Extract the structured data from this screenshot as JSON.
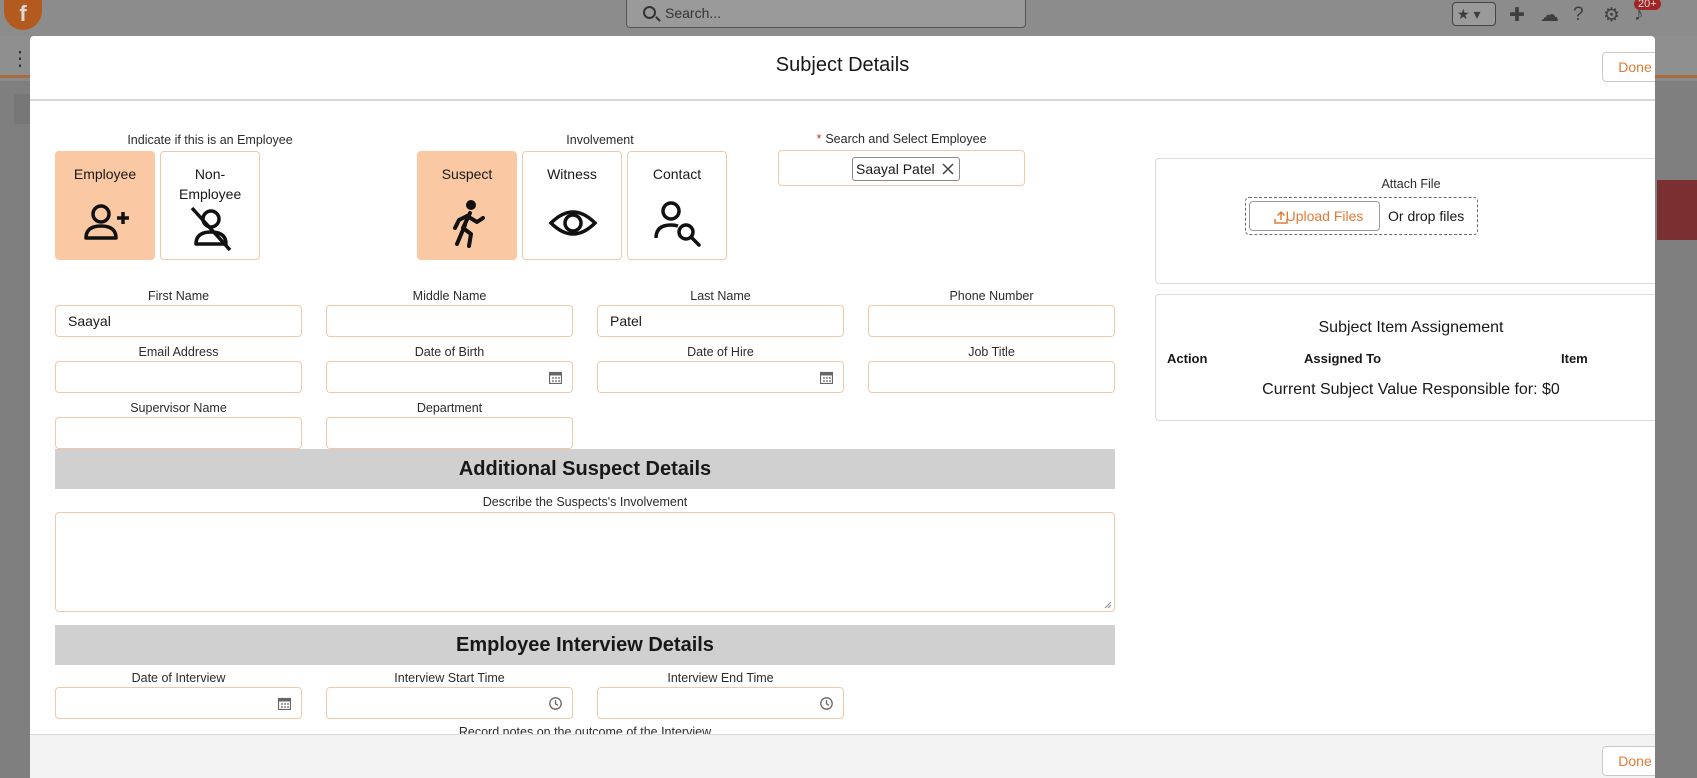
{
  "background": {
    "search_placeholder": "Search...",
    "notification_badge": "20+"
  },
  "modal": {
    "title": "Subject Details",
    "done_label": "Done"
  },
  "employee_indicator": {
    "label": "Indicate if this is an Employee",
    "options": [
      {
        "label": "Employee",
        "selected": true,
        "icon": "add-user-icon"
      },
      {
        "label": "Non-Employee",
        "selected": false,
        "icon": "user-slash-icon"
      }
    ]
  },
  "involvement": {
    "label": "Involvement",
    "options": [
      {
        "label": "Suspect",
        "selected": true,
        "icon": "running-person-icon"
      },
      {
        "label": "Witness",
        "selected": false,
        "icon": "eye-icon"
      },
      {
        "label": "Contact",
        "selected": false,
        "icon": "person-search-icon"
      }
    ]
  },
  "employee_search": {
    "label": "Search and Select Employee",
    "required": true,
    "selected": "Saayal Patel"
  },
  "fields": {
    "first_name": {
      "label": "First Name",
      "value": "Saayal"
    },
    "middle_name": {
      "label": "Middle Name",
      "value": ""
    },
    "last_name": {
      "label": "Last Name",
      "value": "Patel"
    },
    "phone_number": {
      "label": "Phone Number",
      "value": ""
    },
    "email_address": {
      "label": "Email Address",
      "value": ""
    },
    "date_of_birth": {
      "label": "Date of Birth",
      "value": ""
    },
    "date_of_hire": {
      "label": "Date of Hire",
      "value": ""
    },
    "job_title": {
      "label": "Job Title",
      "value": ""
    },
    "supervisor_name": {
      "label": "Supervisor Name",
      "value": ""
    },
    "department": {
      "label": "Department",
      "value": ""
    }
  },
  "additional_suspect": {
    "heading": "Additional Suspect Details",
    "involvement_label": "Describe the Suspects's Involvement",
    "involvement_value": ""
  },
  "interview": {
    "heading": "Employee Interview Details",
    "date_label": "Date of Interview",
    "start_label": "Interview Start Time",
    "end_label": "Interview End Time",
    "notes_label": "Record notes on the outcome of the Interview"
  },
  "attach": {
    "label": "Attach File",
    "upload_label": "Upload Files",
    "drop_label": "Or drop files"
  },
  "assignment": {
    "title": "Subject Item Assignement",
    "columns": [
      "Action",
      "Assigned To",
      "Item"
    ],
    "value_text": "Current Subject Value Responsible for: $0"
  },
  "colors": {
    "accent": "#e07b34",
    "selected_tile": "#fbc8a4",
    "field_border": "#f3c8a7"
  }
}
